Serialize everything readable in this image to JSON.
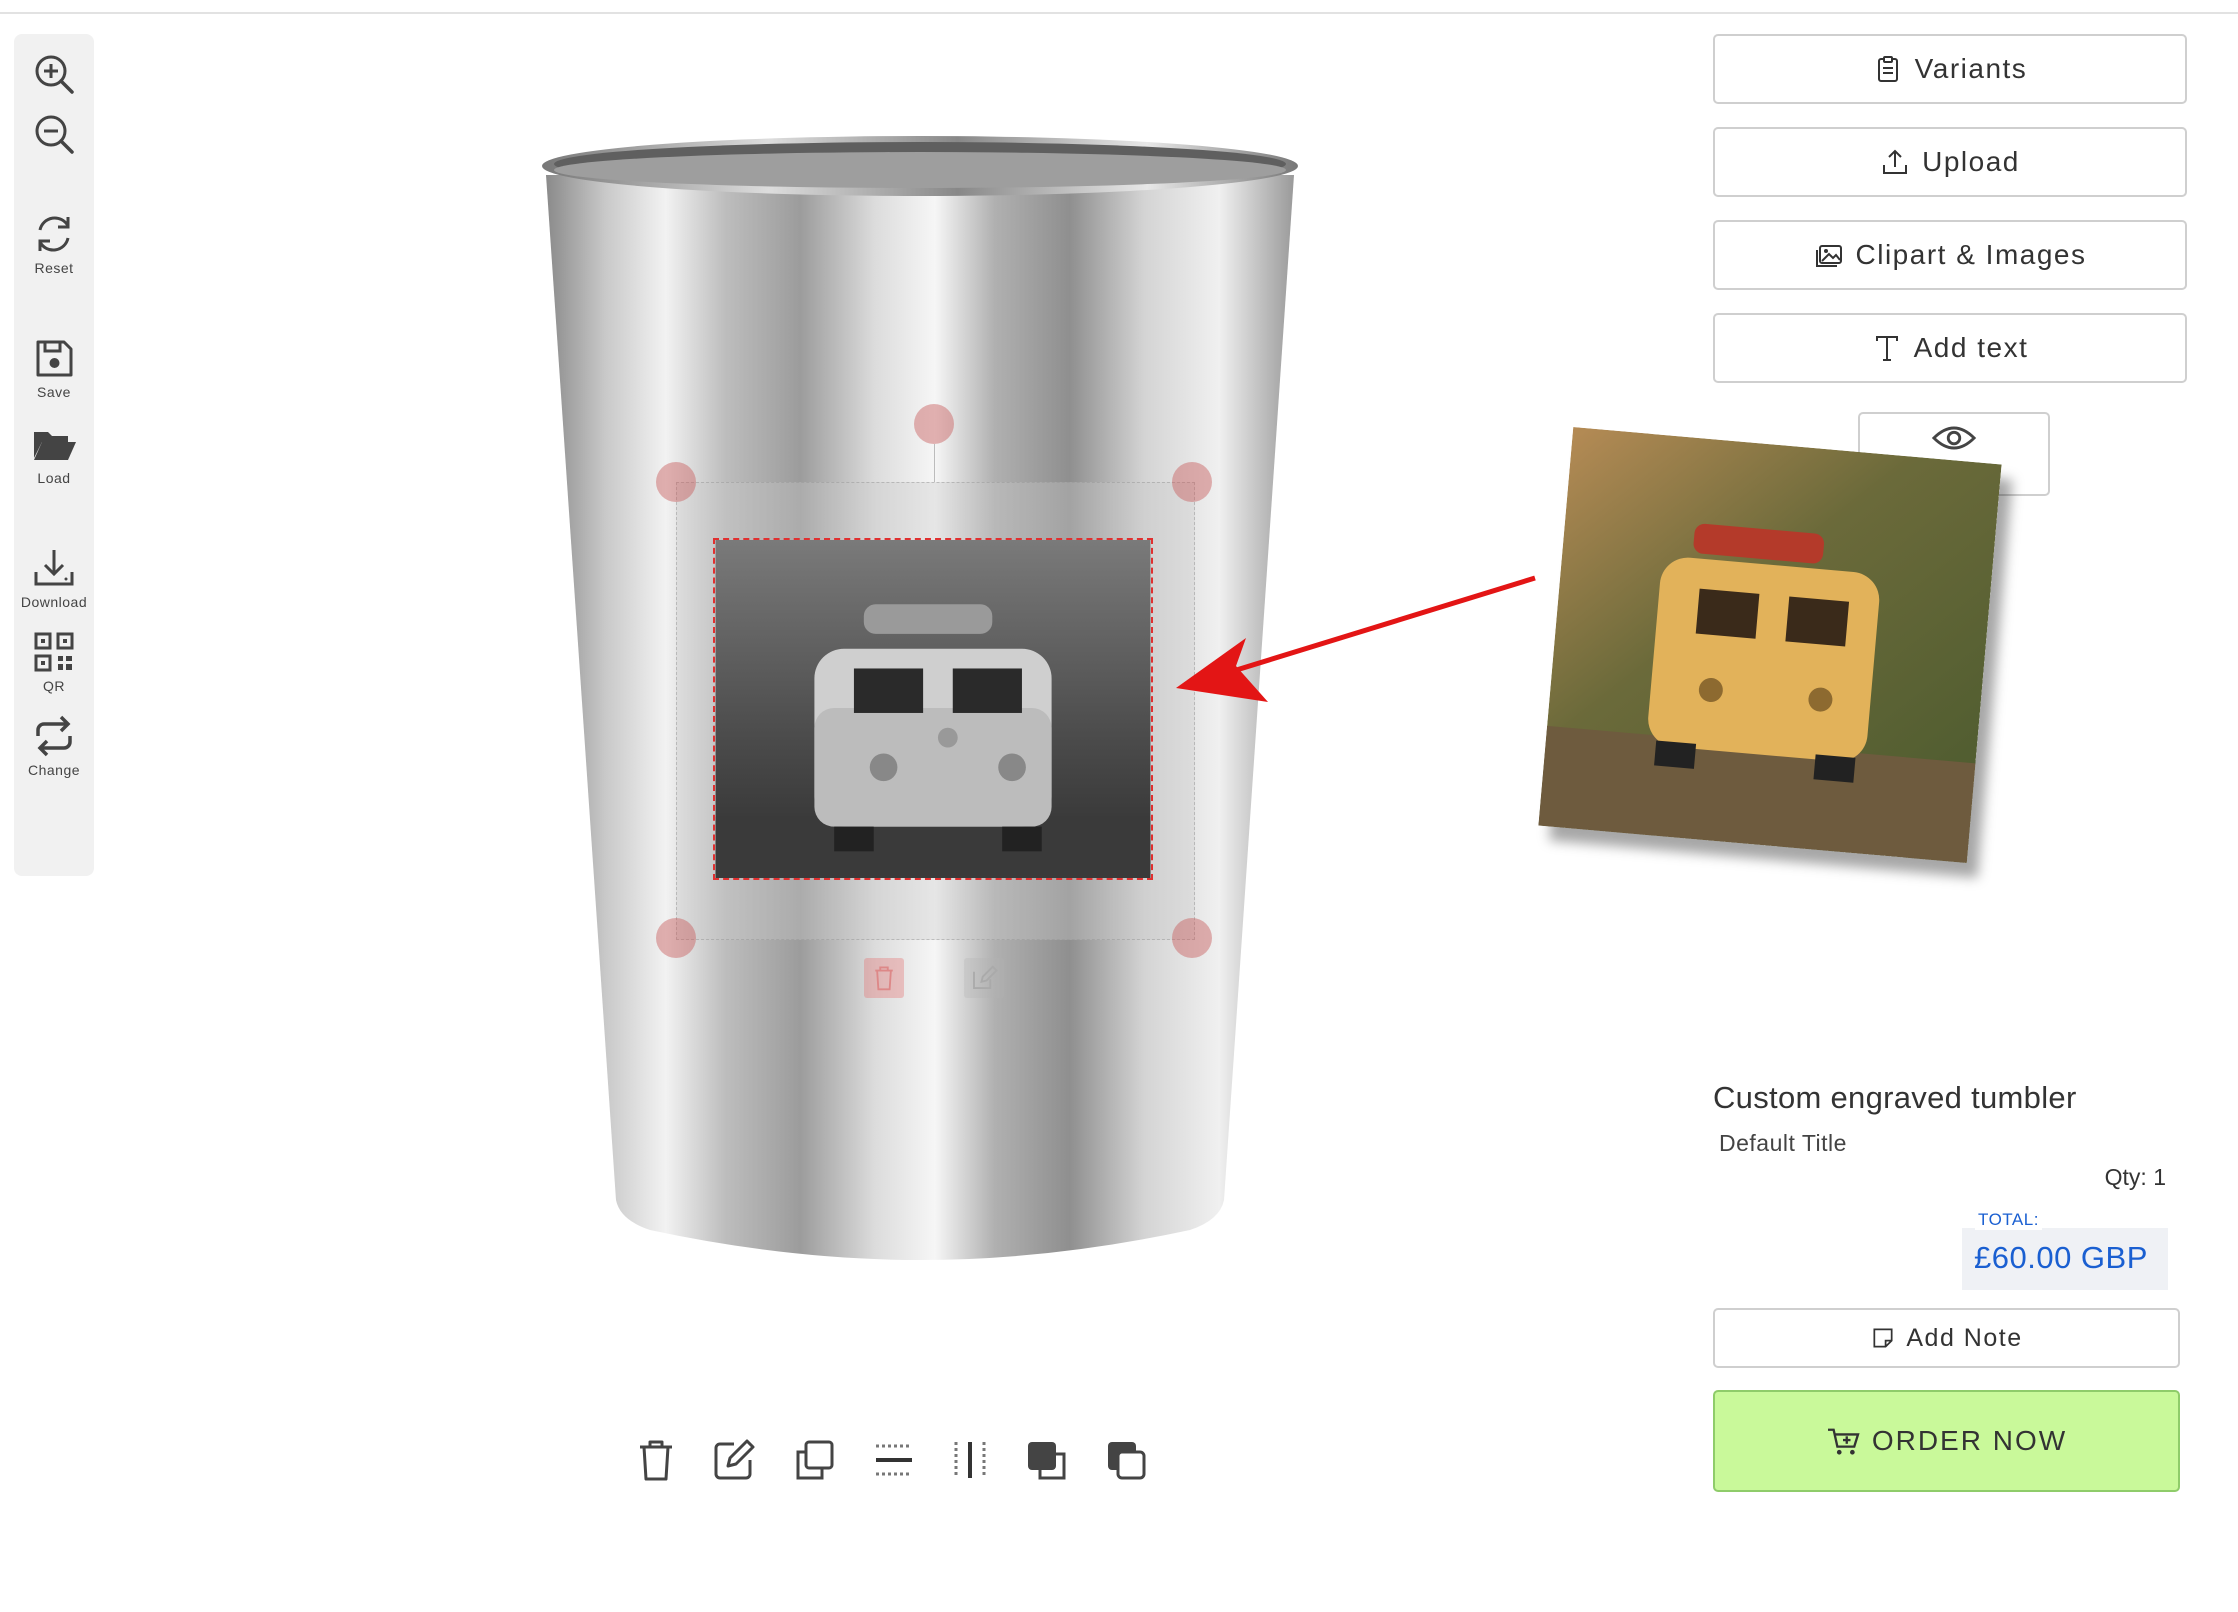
{
  "left_toolbar": {
    "zoom_in_label": "",
    "zoom_out_label": "",
    "reset_label": "Reset",
    "save_label": "Save",
    "load_label": "Load",
    "download_label": "Download",
    "qr_label": "QR",
    "change_label": "Change"
  },
  "right_panel": {
    "variants_label": "Variants",
    "upload_label": "Upload",
    "clipart_label": "Clipart & Images",
    "add_text_label": "Add text"
  },
  "product": {
    "title": "Custom engraved tumbler",
    "variant": "Default Title",
    "qty": "Qty: 1",
    "total_label": "TOTAL:",
    "total_value": "£60.00 GBP"
  },
  "actions": {
    "add_note_label": "Add Note",
    "order_label": "ORDER NOW"
  },
  "icons": {
    "bottom_toolbar": [
      "trash-icon",
      "edit-icon",
      "duplicate-icon",
      "center-horizontal-icon",
      "center-vertical-icon",
      "bring-forward-icon",
      "send-backward-icon"
    ]
  },
  "colors": {
    "order_bg": "#c9f99a",
    "total_text": "#1a5fd1",
    "selection_dash": "#e03030",
    "arrow": "#e31515"
  }
}
